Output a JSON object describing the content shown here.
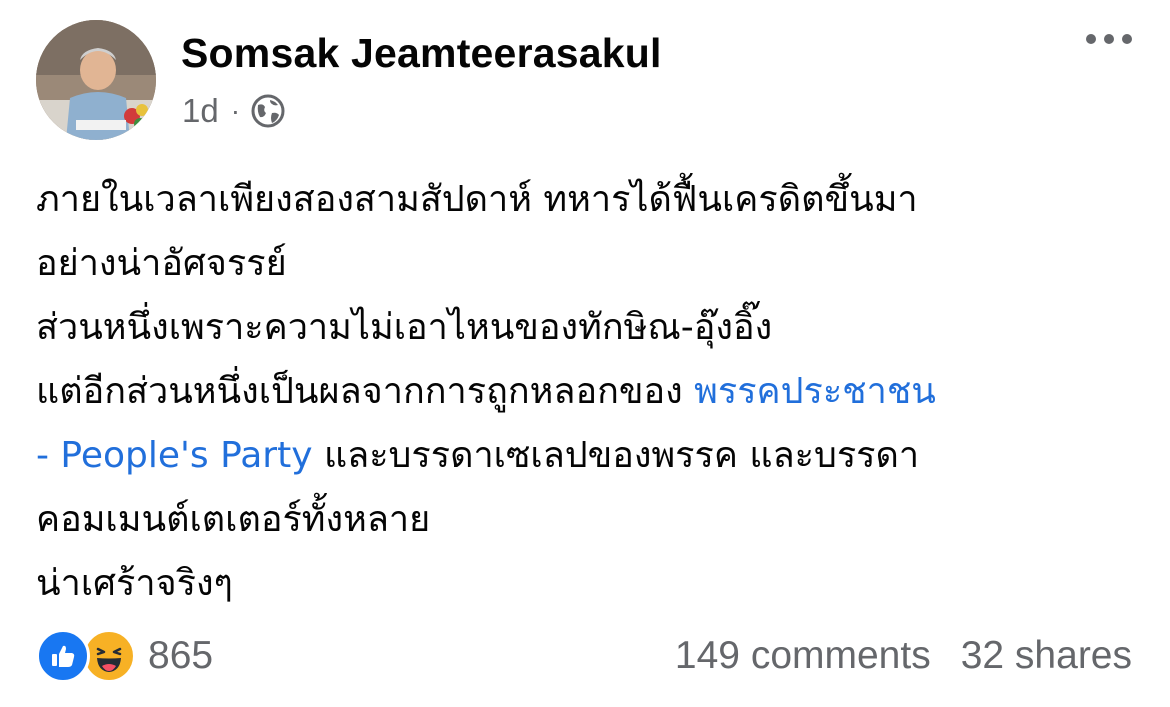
{
  "post": {
    "author": "Somsak Jeamteerasakul",
    "time": "1d",
    "separator": "·",
    "privacy_icon": "globe-icon",
    "more_icon": "more-horizontal-icon",
    "lines": [
      "ภายในเวลาเพียงสองสามสัปดาห์ ทหารได้ฟื้นเครดิตขึ้นมา",
      "อย่างน่าอัศจรรย์",
      "ส่วนหนึ่งเพราะความไม่เอาไหนของทักษิณ-อุ๊งอิ๊ง",
      "แต่อีกส่วนหนึ่งเป็นผลจากการถูกหลอกของ "
    ],
    "mention_part1": "พรรคประชาชน",
    "mention_part2": "- People's Party",
    "line5_rest": " และบรรดาเซเลปของพรรค และบรรดา",
    "lines_after": [
      "คอมเมนต์เตเตอร์ทั้งหลาย",
      "น่าเศร้าจริงๆ"
    ],
    "reaction_icons": [
      "like-icon",
      "haha-icon"
    ],
    "reaction_count": "865",
    "comments": "149 comments",
    "shares": "32 shares",
    "colors": {
      "link": "#216fdb",
      "like": "#1877f2",
      "haha": "#f7b125",
      "muted": "#65676b"
    }
  }
}
